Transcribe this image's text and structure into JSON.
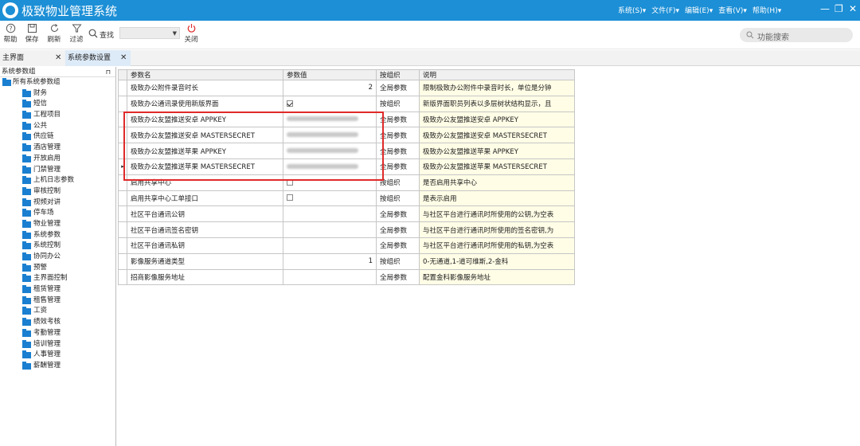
{
  "app": {
    "title": "极致物业管理系统",
    "menus": [
      "系统(S)▾",
      "文件(F)▾",
      "编辑(E)▾",
      "查看(V)▾",
      "帮助(H)▾"
    ],
    "window_controls": [
      "—",
      "❐",
      "✕"
    ]
  },
  "toolbar": {
    "help": "帮助",
    "save": "保存",
    "refresh": "刷新",
    "filter": "过滤",
    "find": "查找",
    "find_value": "",
    "close": "关闭",
    "search_placeholder": "功能搜索"
  },
  "tabs": [
    {
      "label": "主界面",
      "close": "✕"
    },
    {
      "label": "系统参数设置",
      "close": "✕"
    }
  ],
  "sidebar": {
    "header": "系统参数组",
    "pin": "⊓",
    "root": "所有系统参数组",
    "items": [
      "财务",
      "短信",
      "工程项目",
      "公共",
      "供应链",
      "酒店管理",
      "开放启用",
      "门禁管理",
      "上机日志参数",
      "审核控制",
      "视频对讲",
      "停车场",
      "物业管理",
      "系统参数",
      "系统控制",
      "协同办公",
      "预警",
      "主界面控制",
      "租赁管理",
      "租售管理",
      "工资",
      "绩效考核",
      "考勤管理",
      "培训管理",
      "人事管理",
      "薪酬管理"
    ]
  },
  "grid": {
    "headers": [
      "参数名",
      "参数值",
      "按组织",
      "说明"
    ],
    "rows": [
      {
        "name": "极致办公附件录音时长",
        "value": "2",
        "scope": "全局参数",
        "desc": "限制极致办公附件中录音时长，单位是分钟",
        "type": "text",
        "marker": ""
      },
      {
        "name": "极致办公通讯录使用新版界面",
        "value": "",
        "scope": "按组织",
        "desc": "新版界面职员列表以多层树状结构显示，且",
        "type": "check-on",
        "marker": ""
      },
      {
        "name": "极致办公友盟推送安卓 APPKEY",
        "value": "",
        "scope": "全局参数",
        "desc": "极致办公友盟推送安卓 APPKEY",
        "type": "blur",
        "marker": ""
      },
      {
        "name": "极致办公友盟推送安卓 MASTERSECRET",
        "value": "",
        "scope": "全局参数",
        "desc": "极致办公友盟推送安卓 MASTERSECRET",
        "type": "blur",
        "marker": ""
      },
      {
        "name": "极致办公友盟推送苹果 APPKEY",
        "value": "",
        "scope": "全局参数",
        "desc": "极致办公友盟推送苹果 APPKEY",
        "type": "blur",
        "marker": ""
      },
      {
        "name": "极致办公友盟推送苹果 MASTERSECRET",
        "value": "",
        "scope": "全局参数",
        "desc": "极致办公友盟推送苹果 MASTERSECRET",
        "type": "blur",
        "marker": "▸"
      },
      {
        "name": "启用共享中心",
        "value": "",
        "scope": "按组织",
        "desc": "是否启用共享中心",
        "type": "check-off",
        "marker": ""
      },
      {
        "name": "启用共享中心工单接口",
        "value": "",
        "scope": "按组织",
        "desc": "是表示启用",
        "type": "check-off",
        "marker": ""
      },
      {
        "name": "社区平台通讯公钥",
        "value": "",
        "scope": "全局参数",
        "desc": "与社区平台进行通讯时所使用的公钥,为空表",
        "type": "text",
        "marker": ""
      },
      {
        "name": "社区平台通讯签名密钥",
        "value": "",
        "scope": "全局参数",
        "desc": "与社区平台进行通讯时所使用的签名密钥,为",
        "type": "text",
        "marker": ""
      },
      {
        "name": "社区平台通讯私钥",
        "value": "",
        "scope": "全局参数",
        "desc": "与社区平台进行通讯时所使用的私钥,为空表",
        "type": "text",
        "marker": ""
      },
      {
        "name": "影像服务通道类型",
        "value": "1",
        "scope": "按组织",
        "desc": "0-无通道,1-道可维斯,2-金科",
        "type": "text",
        "marker": ""
      },
      {
        "name": "招商影像服务地址",
        "value": "",
        "scope": "全局参数",
        "desc": "配置金科影像服务地址",
        "type": "text",
        "marker": ""
      }
    ]
  }
}
